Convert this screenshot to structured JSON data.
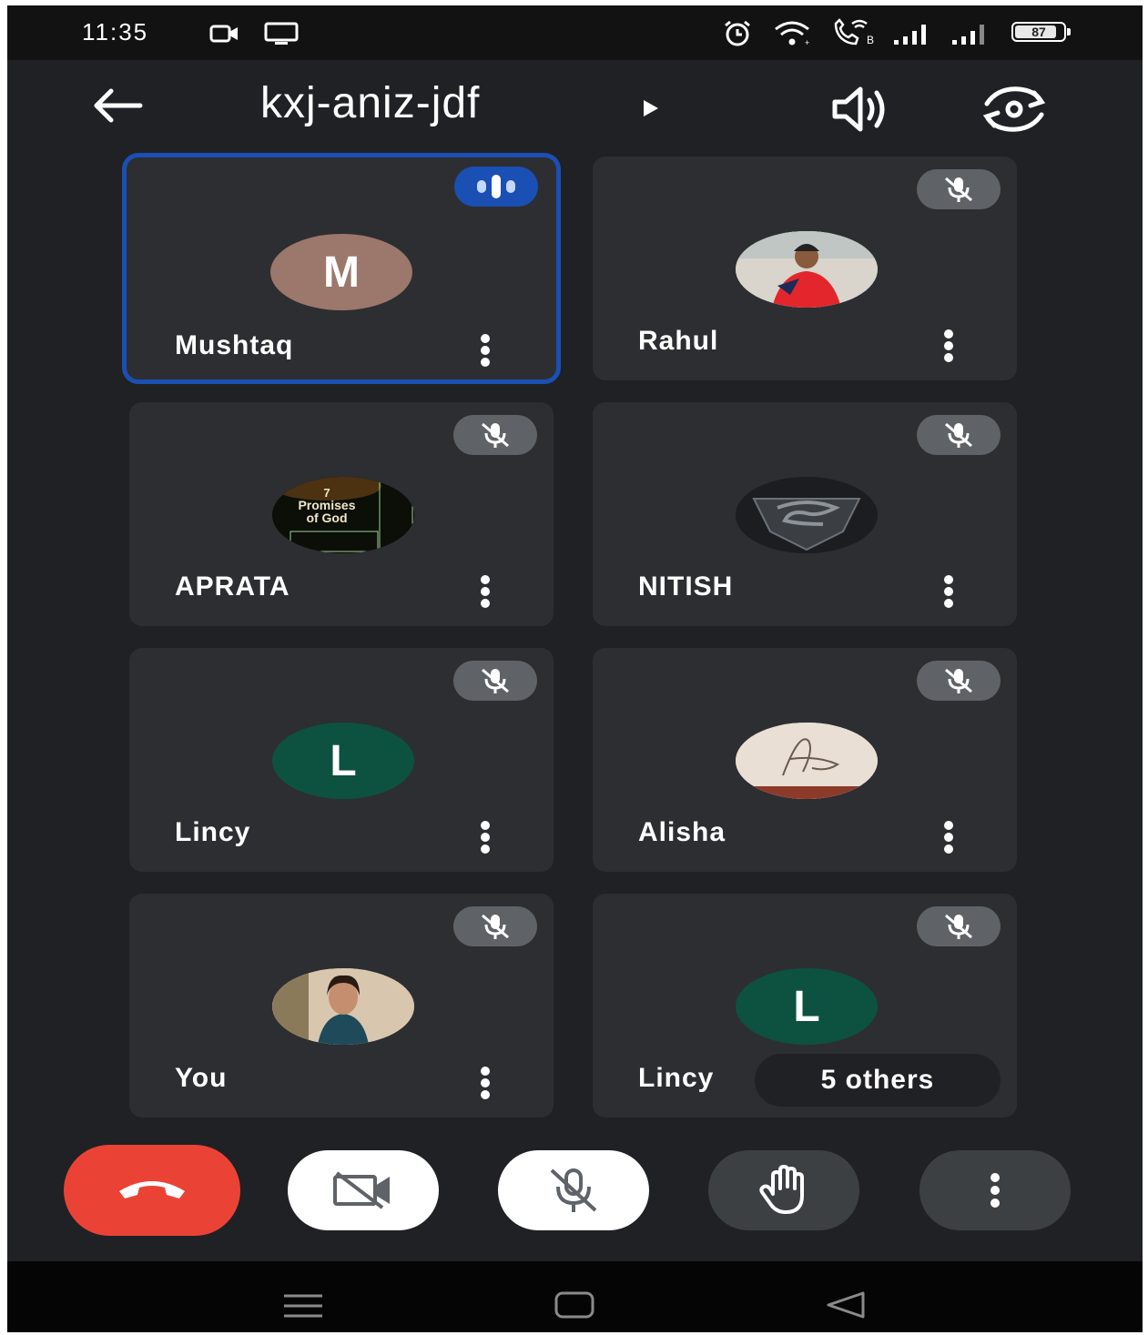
{
  "status_bar": {
    "time": "11:35",
    "battery": "87",
    "battery_level": 0.87,
    "left_icons": [
      "video-call-status-icon",
      "screen-cast-icon"
    ],
    "right_icons": [
      "alarm-icon",
      "wifi-icon",
      "wifi-calling-icon",
      "signal-icon",
      "signal-icon"
    ]
  },
  "top_bar": {
    "title": "kxj-aniz-jdf",
    "back_icon": "arrow-left-icon",
    "speaker_icon": "speaker-icon",
    "flip_camera_icon": "flip-camera-icon"
  },
  "participants": [
    {
      "name": "Mushtaq",
      "initial": "M",
      "avatar_color": "#9c776b",
      "speaking": true
    },
    {
      "name": "Rahul",
      "avatar": "photo",
      "muted": true
    },
    {
      "name": "APRATA",
      "avatar": "photo",
      "avatar_text": [
        "7",
        "Promises",
        "of God"
      ],
      "muted": true
    },
    {
      "name": "NITISH",
      "avatar": "photo",
      "muted": true
    },
    {
      "name": "Lincy",
      "initial": "L",
      "avatar_color": "#0d5240",
      "muted": true
    },
    {
      "name": "Alisha",
      "avatar": "photo",
      "muted": true
    },
    {
      "name": "You",
      "avatar": "photo",
      "muted": true
    },
    {
      "name": "Lincy",
      "initial": "L",
      "avatar_color": "#0d5240",
      "muted": true,
      "others_label": "5 others"
    }
  ],
  "controls": {
    "end_call_color": "#ea4335",
    "items": [
      "end-call-icon",
      "camera-off-icon",
      "mic-off-icon",
      "raise-hand-icon",
      "more-vert-icon"
    ]
  },
  "colors": {
    "background": "#202124",
    "tile": "#2d2e31",
    "speaking_border": "#1a4fb4",
    "mute_badge": "#5f6368"
  }
}
